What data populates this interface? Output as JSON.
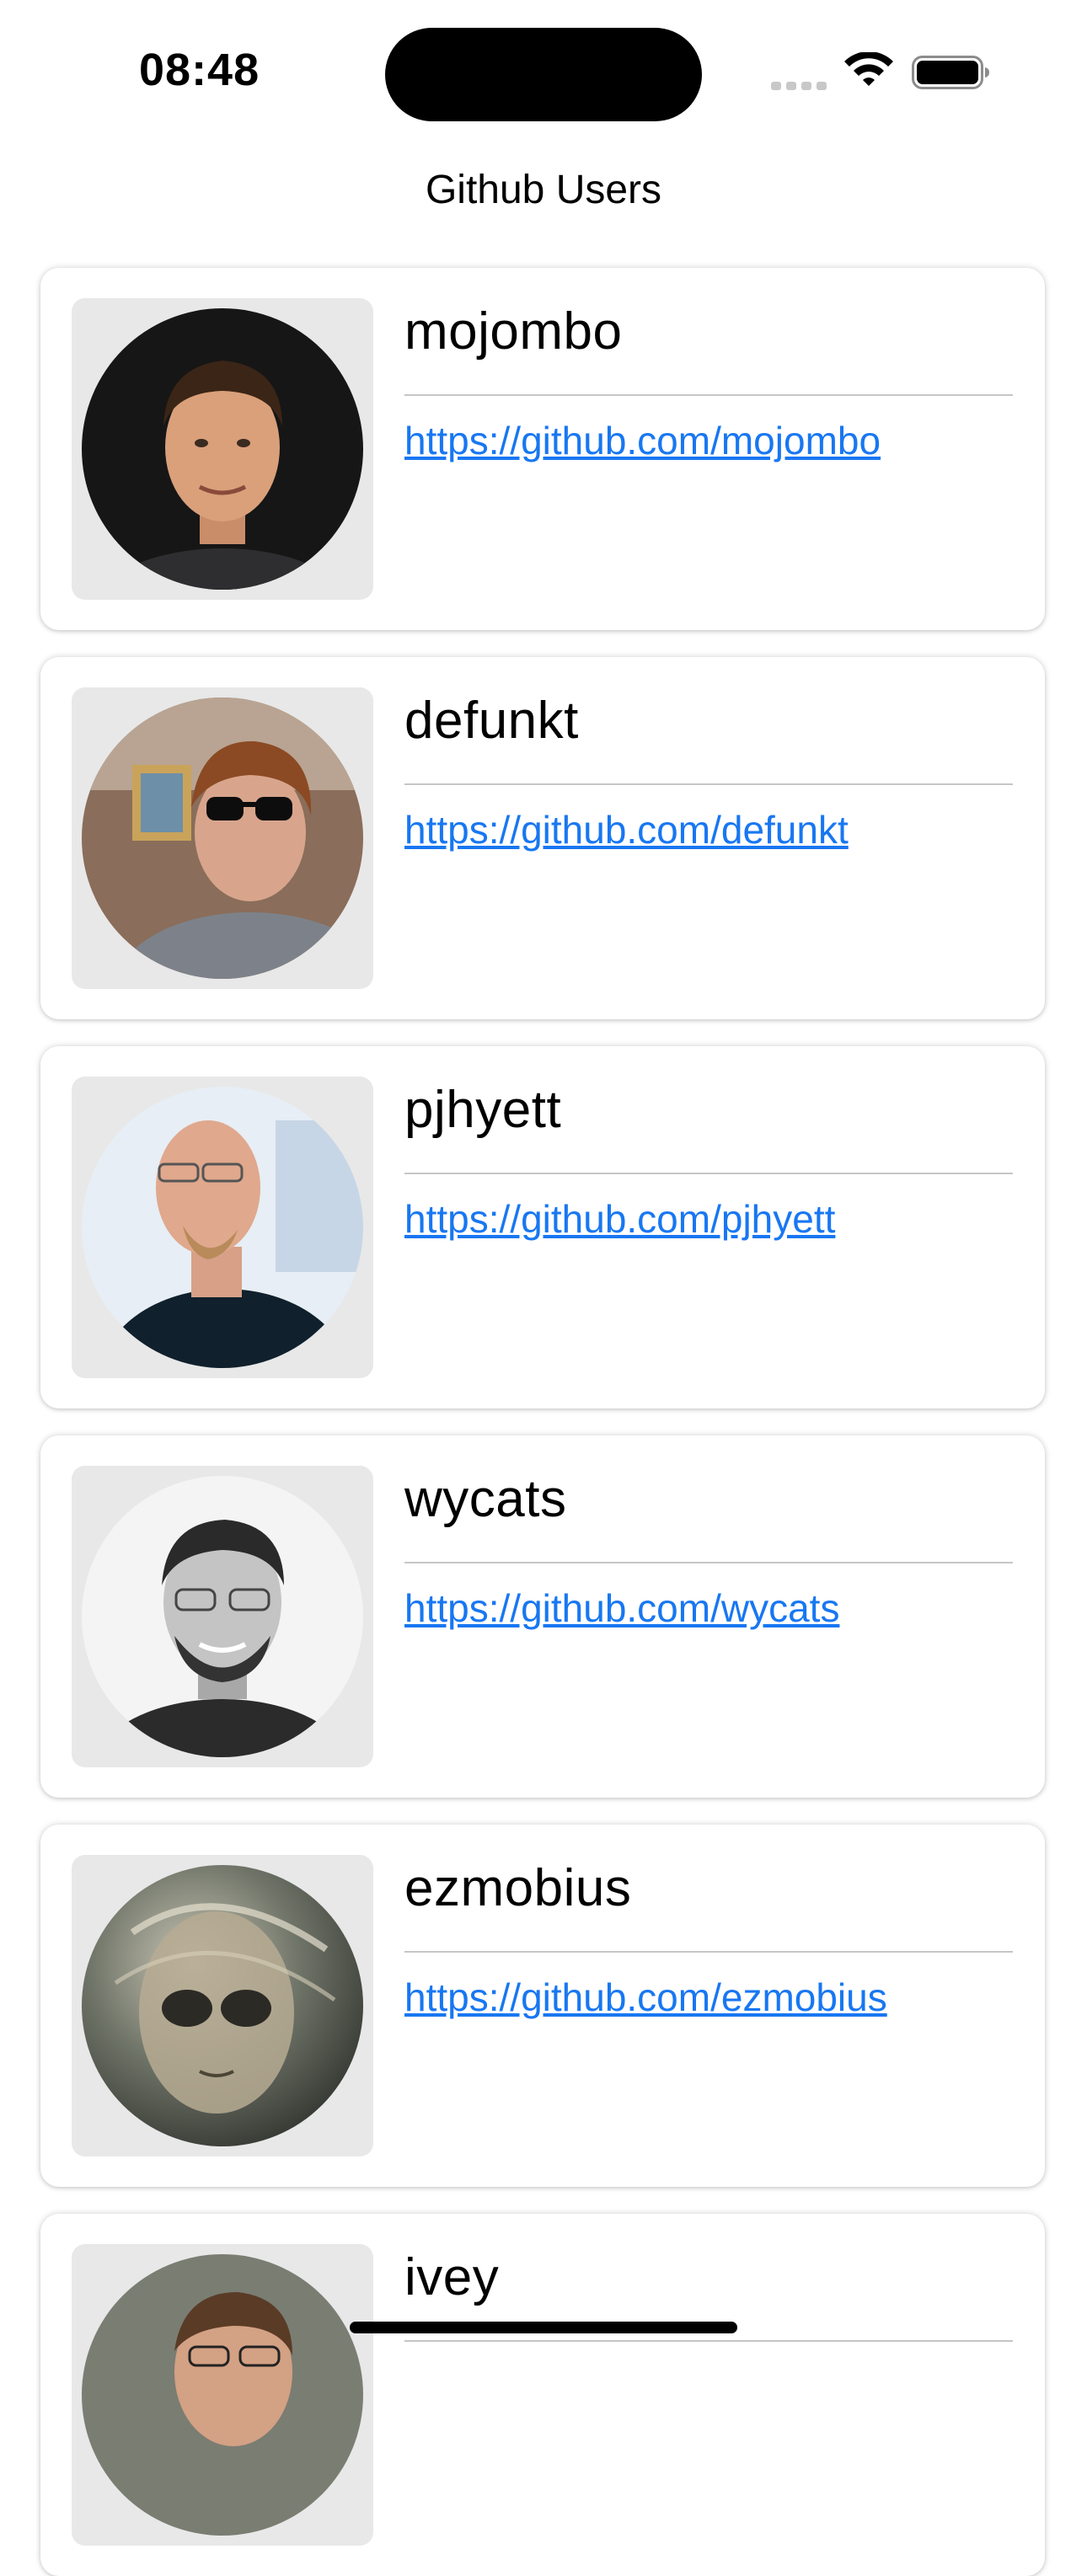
{
  "status_bar": {
    "time": "08:48",
    "icons": [
      "signal-icon",
      "wifi-icon",
      "battery-icon"
    ]
  },
  "nav": {
    "title": "Github Users"
  },
  "users": [
    {
      "login": "mojombo",
      "url": "https://github.com/mojombo",
      "avatar": "person-avatar-dark-background"
    },
    {
      "login": "defunkt",
      "url": "https://github.com/defunkt",
      "avatar": "person-avatar-sunglasses"
    },
    {
      "login": "pjhyett",
      "url": "https://github.com/pjhyett",
      "avatar": "person-avatar-glasses-outdoor"
    },
    {
      "login": "wycats",
      "url": "https://github.com/wycats",
      "avatar": "person-avatar-grayscale"
    },
    {
      "login": "ezmobius",
      "url": "https://github.com/ezmobius",
      "avatar": "illustrated-alien-avatar"
    },
    {
      "login": "ivey",
      "url": "",
      "avatar": "person-avatar-glasses-beard"
    }
  ],
  "colors": {
    "link": "#1877f2",
    "card_background": "#ffffff",
    "avatar_frame": "#e8e8e8",
    "divider": "#c6c6c8"
  }
}
